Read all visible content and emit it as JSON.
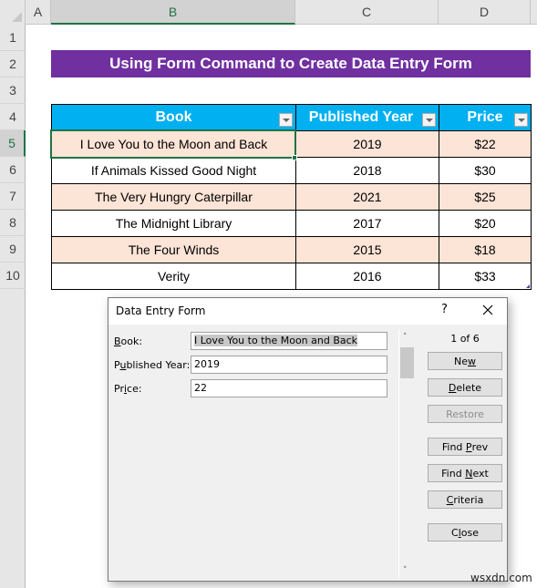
{
  "spreadsheet": {
    "corner_icon": "select-all-triangle",
    "columns": [
      "A",
      "B",
      "C",
      "D"
    ],
    "selected_column": "B",
    "rows": [
      "1",
      "2",
      "3",
      "4",
      "5",
      "6",
      "7",
      "8",
      "9",
      "10"
    ],
    "selected_row": "5",
    "title_banner": "Using Form Command to Create Data Entry Form",
    "accent_color": "#7030a0",
    "header_color": "#00b0f0",
    "band_color": "#fce4d6",
    "selection_color": "#217346"
  },
  "table": {
    "headers": [
      "Book",
      "Published Year",
      "Price"
    ],
    "filter_icon": "dropdown-filter-icon",
    "rows": [
      {
        "book": "I Love You to the Moon and Back",
        "year": "2019",
        "price": "$22"
      },
      {
        "book": "If Animals Kissed Good Night",
        "year": "2018",
        "price": "$30"
      },
      {
        "book": "The Very Hungry Caterpillar",
        "year": "2021",
        "price": "$25"
      },
      {
        "book": "The Midnight Library",
        "year": "2017",
        "price": "$20"
      },
      {
        "book": "The Four Winds",
        "year": "2015",
        "price": "$18"
      },
      {
        "book": "Verity",
        "year": "2016",
        "price": "$33"
      }
    ]
  },
  "dialog": {
    "title": "Data Entry Form",
    "help_label": "?",
    "close_icon": "close-x-icon",
    "fields": [
      {
        "label_pre": "",
        "label_key": "B",
        "label_post": "ook:",
        "value": "I Love You to the Moon and Back"
      },
      {
        "label_pre": "P",
        "label_key": "u",
        "label_post": "blished Year:",
        "value": "2019"
      },
      {
        "label_pre": "Pr",
        "label_key": "i",
        "label_post": "ce:",
        "value": "22"
      }
    ],
    "record_counter": "1 of 6",
    "buttons": [
      {
        "pre": "Ne",
        "key": "w",
        "post": "",
        "enabled": true
      },
      {
        "pre": "",
        "key": "D",
        "post": "elete",
        "enabled": true
      },
      {
        "pre": "Restore",
        "key": "",
        "post": "",
        "enabled": false
      },
      {
        "pre": "Find ",
        "key": "P",
        "post": "rev",
        "enabled": true
      },
      {
        "pre": "Find ",
        "key": "N",
        "post": "ext",
        "enabled": true
      },
      {
        "pre": "",
        "key": "C",
        "post": "riteria",
        "enabled": true
      },
      {
        "pre": "C",
        "key": "l",
        "post": "ose",
        "enabled": true
      }
    ],
    "scroll_up_icon": "chevron-up-icon",
    "scroll_down_icon": "chevron-down-icon"
  },
  "watermark": "wsxdn.com"
}
